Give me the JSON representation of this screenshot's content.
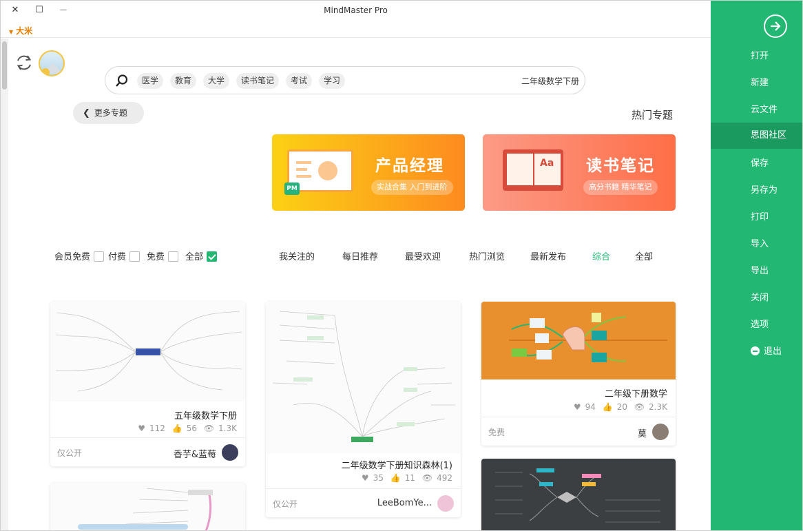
{
  "window": {
    "title": "MindMaster Pro",
    "close_glyph": "✕",
    "maximize_glyph": "☐",
    "minimize_glyph": "—",
    "user_name": "大米"
  },
  "sidebar": {
    "color": "#22b873",
    "back_icon": "arrow-circle-right-icon",
    "items": [
      {
        "label": "打开"
      },
      {
        "label": "新建"
      },
      {
        "label": "云文件"
      },
      {
        "label": "思图社区",
        "active": true
      },
      {
        "label": "保存"
      },
      {
        "label": "另存为"
      },
      {
        "label": "打印"
      },
      {
        "label": "导入"
      },
      {
        "label": "导出"
      },
      {
        "label": "关闭"
      },
      {
        "label": "选项"
      },
      {
        "label": "退出",
        "icon": "minus-circle-icon"
      }
    ]
  },
  "search": {
    "value": "二年级数学下册",
    "tags": [
      "学习",
      "考试",
      "读书笔记",
      "大学",
      "教育",
      "医学"
    ]
  },
  "topics": {
    "heading": "热门专题",
    "more_label": "更多专题",
    "banners": [
      {
        "title": "读书笔记",
        "subtitle": "高分书籍 精华笔记",
        "colors": [
          "#fc9a86",
          "#fe6e47"
        ]
      },
      {
        "title": "产品经理",
        "subtitle": "实战合集 入门到进阶",
        "badge": "PM",
        "colors": [
          "#fcd114",
          "#fd8b1f"
        ]
      }
    ]
  },
  "tabs": {
    "items": [
      "全部",
      "综合",
      "最新发布",
      "热门浏览",
      "最受欢迎",
      "每日推荐",
      "我关注的"
    ],
    "active": "综合"
  },
  "filters": {
    "items": [
      {
        "label": "全部",
        "checked": true
      },
      {
        "label": "免费",
        "checked": false
      },
      {
        "label": "付费",
        "checked": false
      },
      {
        "label": "会员免费",
        "checked": false
      }
    ]
  },
  "cards": [
    {
      "title": "二年级下册数学",
      "views": "2.3K",
      "likes": "20",
      "favorites": "94",
      "author": "莫",
      "type": "免费",
      "thumb_bg": "#e8902e"
    },
    {
      "title": "二年级数学下册知识森林(1)",
      "views": "492",
      "likes": "11",
      "favorites": "35",
      "author": "LeeBomYe...",
      "type": "仅公开"
    },
    {
      "title": "五年级数学下册",
      "views": "1.3K",
      "likes": "56",
      "favorites": "112",
      "author": "香芋&蓝莓",
      "type": "仅公开"
    }
  ]
}
